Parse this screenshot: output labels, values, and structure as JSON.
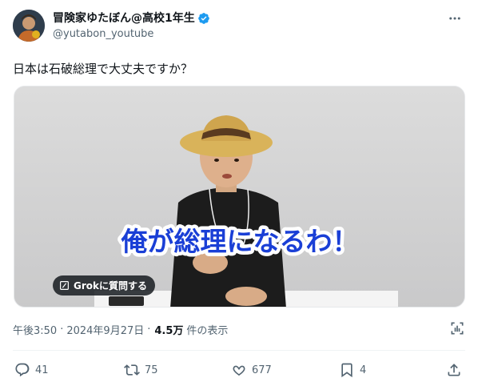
{
  "author": {
    "display_name": "冒険家ゆたぼん@高校1年生",
    "handle": "@yutabon_youtube"
  },
  "tweet": {
    "text": "日本は石破総理で大丈夫ですか？"
  },
  "media": {
    "caption": "俺が総理になるわ！",
    "grok_label": "Grokに質問する"
  },
  "meta": {
    "time": "午後3:50",
    "separator": "·",
    "date": "2024年9月27日",
    "separator2": "·",
    "views_count": "4.5万",
    "views_label": "件の表示"
  },
  "actions": {
    "replies": "41",
    "retweets": "75",
    "likes": "677",
    "bookmarks": "4"
  },
  "colors": {
    "verified": "#1d9bf0",
    "muted": "#536471",
    "text": "#0f1419",
    "caption_fill": "#1a3fd6"
  },
  "icons": [
    "more-icon",
    "verified-icon",
    "grok-icon",
    "analytics-icon",
    "reply-icon",
    "retweet-icon",
    "like-icon",
    "bookmark-icon",
    "share-icon"
  ]
}
